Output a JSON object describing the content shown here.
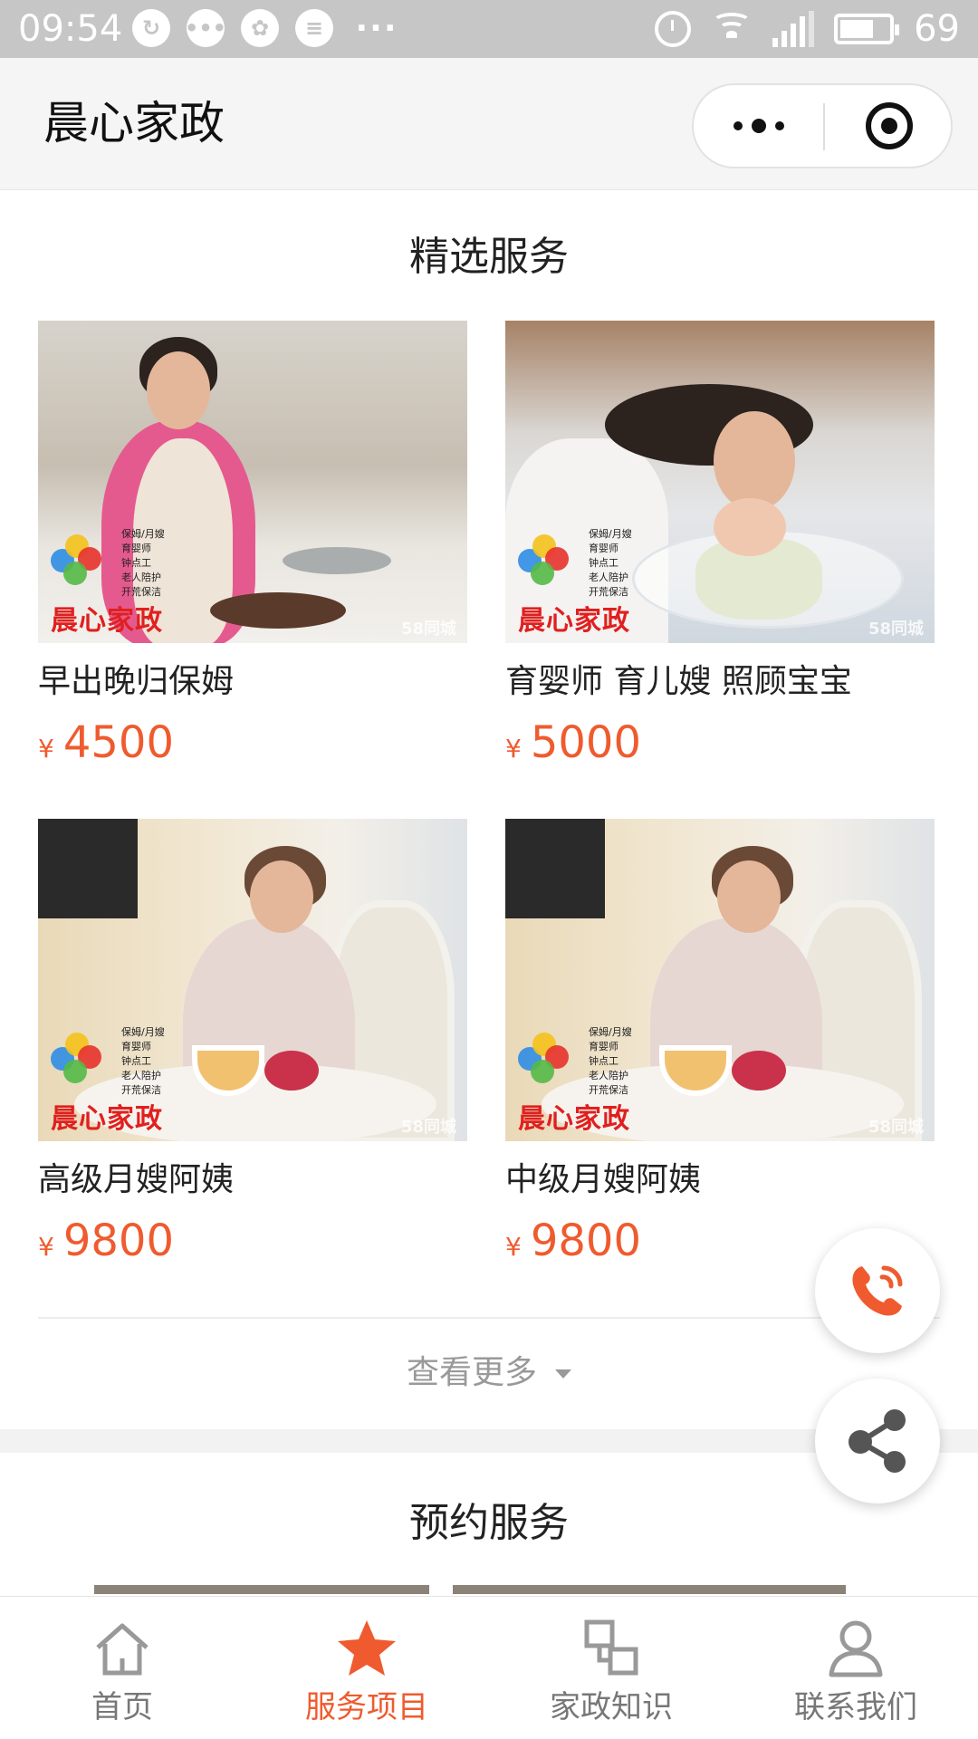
{
  "status_bar": {
    "time": "09:54",
    "battery": "69",
    "network": "4G",
    "battery_level": 0.69
  },
  "title_bar": {
    "title": "晨心家政"
  },
  "featured": {
    "title": "精选服务",
    "items": [
      {
        "name": "早出晚归保姆",
        "currency": "¥",
        "price": "4500"
      },
      {
        "name": "育婴师 育儿嫂 照顾宝宝",
        "currency": "¥",
        "price": "5000"
      },
      {
        "name": "高级月嫂阿姨",
        "currency": "¥",
        "price": "9800"
      },
      {
        "name": "中级月嫂阿姨",
        "currency": "¥",
        "price": "9800"
      }
    ],
    "more_label": "查看更多"
  },
  "watermark": {
    "brand": "晨心家政",
    "services": [
      "保姆/月嫂",
      "育婴师",
      "钟点工",
      "老人陪护",
      "开荒保洁"
    ],
    "source": "58同城"
  },
  "reserve": {
    "title": "预约服务"
  },
  "tabs": [
    {
      "label": "首页",
      "icon": "home-icon"
    },
    {
      "label": "服务项目",
      "icon": "star-icon",
      "active": true
    },
    {
      "label": "家政知识",
      "icon": "knowledge-icon"
    },
    {
      "label": "联系我们",
      "icon": "person-icon"
    }
  ],
  "colors": {
    "accent": "#ef5b2e",
    "text": "#222222",
    "muted": "#999999",
    "statusbar": "#c6c6c6"
  }
}
